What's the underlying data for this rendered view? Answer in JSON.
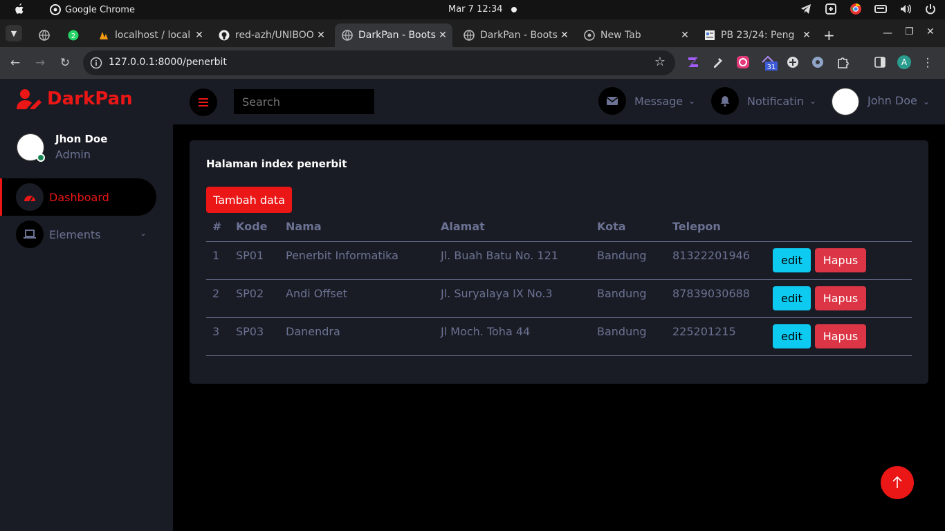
{
  "os": {
    "app_name": "Google Chrome",
    "clock": "Mar 7  12:34"
  },
  "browser": {
    "tabs": [
      {
        "title": "localhost / local"
      },
      {
        "title": "red-azh/UNIBOO"
      },
      {
        "title": "DarkPan - Boots"
      },
      {
        "title": "DarkPan - Boots"
      },
      {
        "title": "New Tab"
      },
      {
        "title": "PB 23/24: Peng"
      }
    ],
    "whatsapp_badge": "2",
    "url": "127.0.0.1:8000/penerbit",
    "calendar_ext_label": "31",
    "profile_initial": "A"
  },
  "sidebar": {
    "brand": "DarkPan",
    "profile_name": "Jhon Doe",
    "profile_role": "Admin",
    "items": [
      {
        "label": "Dashboard"
      },
      {
        "label": "Elements"
      }
    ]
  },
  "topnav": {
    "search_placeholder": "Search",
    "message_label": "Message",
    "notification_label": "Notificatin",
    "user_name": "John Doe"
  },
  "main": {
    "title": "Halaman index penerbit",
    "add_button": "Tambah data",
    "columns": [
      "#",
      "Kode",
      "Nama",
      "Alamat",
      "Kota",
      "Telepon"
    ],
    "rows": [
      {
        "no": "1",
        "kode": "SP01",
        "nama": "Penerbit Informatika",
        "alamat": "Jl. Buah Batu No. 121",
        "kota": "Bandung",
        "telepon": "81322201946"
      },
      {
        "no": "2",
        "kode": "SP02",
        "nama": "Andi Offset",
        "alamat": "Jl. Suryalaya IX No.3",
        "kota": "Bandung",
        "telepon": "87839030688"
      },
      {
        "no": "3",
        "kode": "SP03",
        "nama": "Danendra",
        "alamat": "Jl Moch. Toha 44",
        "kota": "Bandung",
        "telepon": "225201215"
      }
    ],
    "edit_label": "edit",
    "delete_label": "Hapus"
  },
  "colors": {
    "accent": "#eb1616",
    "sidebar_bg": "#191c24",
    "muted_text": "#6c7293",
    "edit_button": "#0dcaf0",
    "delete_button": "#dc3545"
  },
  "icons": {
    "apple": "apple-icon",
    "back_to_top": "arrow-up-icon",
    "menu": "bars-icon",
    "message": "envelope-icon",
    "notification": "bell-icon",
    "dashboard": "tachometer-icon",
    "elements": "laptop-icon",
    "brand": "user-edit-icon"
  }
}
